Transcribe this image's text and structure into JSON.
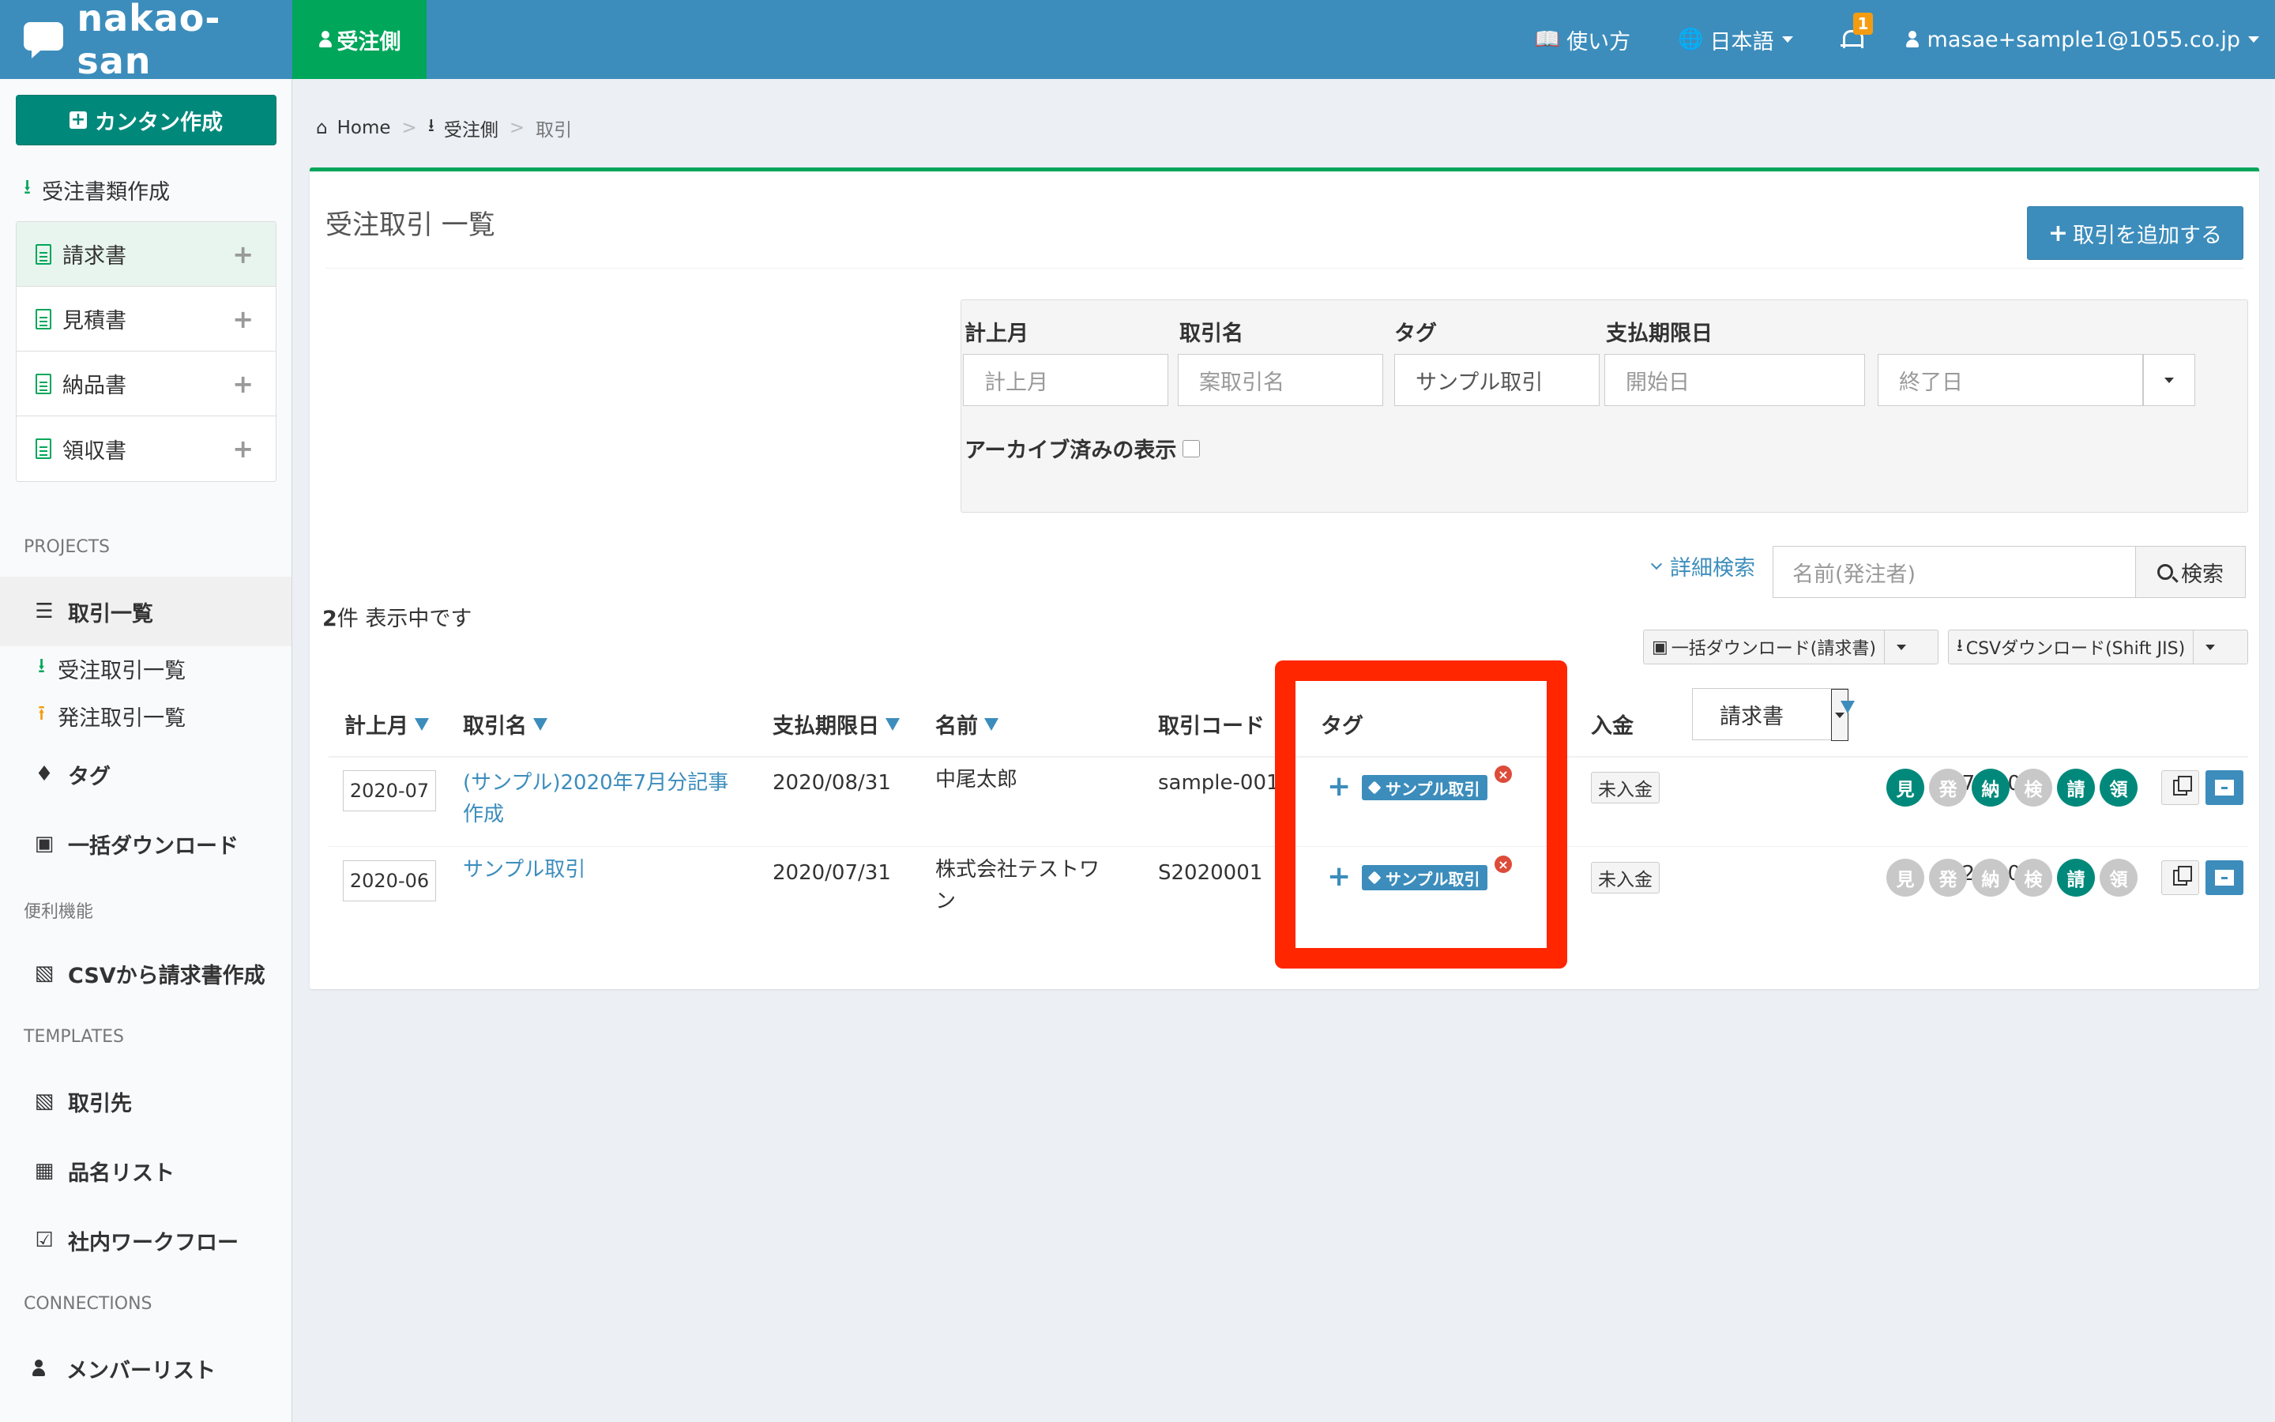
{
  "colors": {
    "header": "#3c8dbc",
    "role_tab": "#00a65a",
    "accent": "#3c8dbc",
    "quick_button": "#00897b",
    "badge": "#f39c12",
    "highlight": "#ff2600"
  },
  "header": {
    "app_name": "nakao-san",
    "role_tab": "受注側",
    "help": "使い方",
    "language": "日本語",
    "notification_count": "1",
    "user": "masae+sample1@1055.co.jp"
  },
  "sidebar": {
    "quick_create": "カンタン作成",
    "order_docs": "受注書類作成",
    "doc_items": [
      "請求書",
      "見積書",
      "納品書",
      "領収書"
    ],
    "projects_label": "PROJECTS",
    "deals": "取引一覧",
    "received_deals": "受注取引一覧",
    "placed_deals": "発注取引一覧",
    "tags": "タグ",
    "bulk_download": "一括ダウンロード",
    "utilities_label": "便利機能",
    "csv_invoice": "CSVから請求書作成",
    "templates_label": "TEMPLATES",
    "clients": "取引先",
    "items": "品名リスト",
    "workflow": "社内ワークフロー",
    "connections_label": "CONNECTIONS",
    "members": "メンバーリスト"
  },
  "breadcrumb": {
    "home": "Home",
    "side": "受注側",
    "current": "取引"
  },
  "main": {
    "title": "受注取引 一覧",
    "add_button": "取引を追加する",
    "filters": {
      "month_label": "計上月",
      "month_placeholder": "計上月",
      "deal_label": "取引名",
      "deal_placeholder": "案取引名",
      "tag_label": "タグ",
      "tag_value": "サンプル取引",
      "due_label": "支払期限日",
      "start_placeholder": "開始日",
      "end_placeholder": "終了日",
      "archive_label": "アーカイブ済みの表示"
    },
    "advanced_search": "詳細検索",
    "search_placeholder": "名前(発注者)",
    "search_button": "検索",
    "count_number": "2",
    "count_text": "件 表示中です",
    "bulk_download_button": "一括ダウンロード(請求書)",
    "csv_download_button": "CSVダウンロード(Shift JIS)",
    "doc_type_select": "請求書"
  },
  "table": {
    "headers": {
      "month": "計上月",
      "deal": "取引名",
      "due": "支払期限日",
      "name": "名前",
      "code": "取引コード",
      "tag": "タグ",
      "payment": "入金"
    },
    "rows": [
      {
        "month": "2020-07",
        "deal_line1": "(サンプル)2020年7月分記事",
        "deal_line2": "作成",
        "due": "2020/08/31",
        "name_line1": "中尾太郎",
        "name_line2": "",
        "code": "sample-001",
        "tag": "サンプル取引",
        "payment": "未入金",
        "amount": "7,700",
        "docs": [
          {
            "label": "見",
            "active": true
          },
          {
            "label": "発",
            "active": false
          },
          {
            "label": "納",
            "active": true
          },
          {
            "label": "検",
            "active": false
          },
          {
            "label": "請",
            "active": true
          },
          {
            "label": "領",
            "active": true
          }
        ]
      },
      {
        "month": "2020-06",
        "deal_line1": "サンプル取引",
        "deal_line2": "",
        "due": "2020/07/31",
        "name_line1": "株式会社テストワ",
        "name_line2": "ン",
        "code": "S2020001",
        "tag": "サンプル取引",
        "payment": "未入金",
        "amount": "462,000",
        "docs": [
          {
            "label": "見",
            "active": false
          },
          {
            "label": "発",
            "active": false
          },
          {
            "label": "納",
            "active": false
          },
          {
            "label": "検",
            "active": false
          },
          {
            "label": "請",
            "active": true
          },
          {
            "label": "領",
            "active": false
          }
        ]
      }
    ]
  },
  "icons": [
    "chat-bubble-icon",
    "person-icon",
    "book-icon",
    "globe-icon",
    "bell-icon",
    "download-icon",
    "document-icon",
    "plus-icon",
    "list-icon",
    "upload-icon",
    "tag-icon",
    "floppy-icon",
    "building-icon",
    "table-icon",
    "checkbox-icon",
    "home-icon",
    "search-icon",
    "copy-icon",
    "archive-icon"
  ]
}
